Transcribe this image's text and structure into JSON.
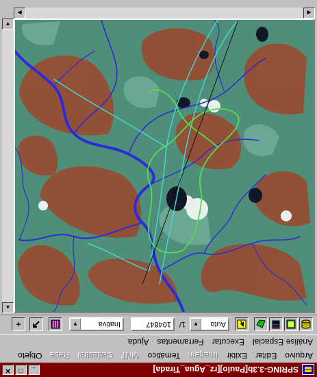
{
  "window": {
    "title": "SPRING-3.3b[Paulo][rz_Agua_Tirada]",
    "buttons": {
      "minimize": "_",
      "maximize": "□",
      "close": "✕"
    }
  },
  "menubar": {
    "row1": [
      "Arquivo",
      "Editar",
      "Exibir",
      "Imagem",
      "Temático",
      "MNT",
      "Cadastral",
      "Rede",
      "Objeto"
    ],
    "row1_disabled": [
      false,
      false,
      false,
      true,
      false,
      true,
      true,
      true,
      false
    ],
    "row2": [
      "Análise Espacial",
      "Executar",
      "Ferramentas",
      "Ajuda"
    ]
  },
  "toolbar": {
    "zoom_mode_value": "Auto",
    "scale_prefix": "1/",
    "scale_value": "104847",
    "display_mode_value": "Inativa",
    "tool_icons": [
      "database-stack-icon",
      "view-icon",
      "layers-icon",
      "draw-icon",
      "cursor-select-icon",
      "palette-icon",
      "arrow-pan-icon",
      "plus-icon"
    ]
  },
  "colors": {
    "title_bar": "#800000",
    "river": "#2b2bd8",
    "road": "#40d8d0",
    "boundary": "#50e050",
    "soil": "#9a4a30",
    "vegetation": "#4f8f7a"
  }
}
